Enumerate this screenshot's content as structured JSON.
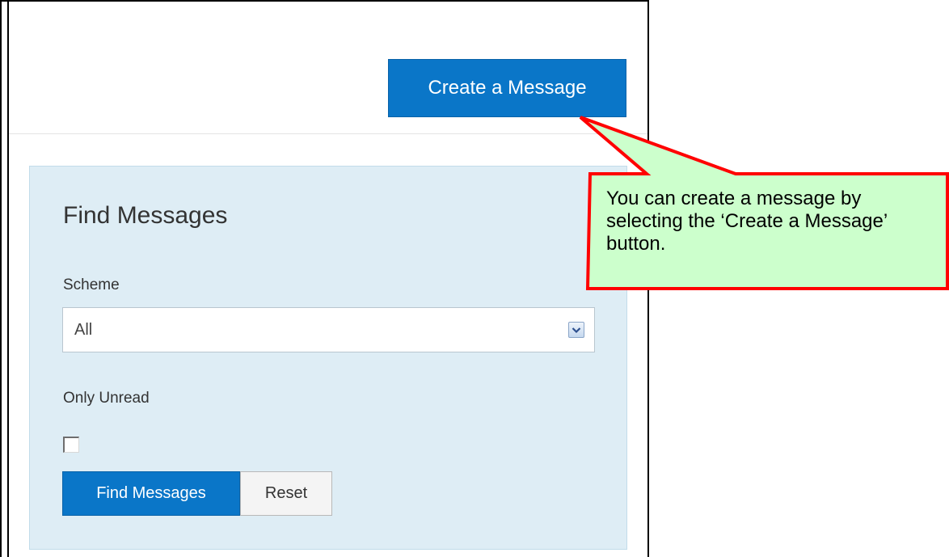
{
  "header": {
    "create_button_label": "Create a Message"
  },
  "filter_panel": {
    "title": "Find Messages",
    "scheme": {
      "label": "Scheme",
      "selected_value": "All"
    },
    "only_unread": {
      "label": "Only Unread",
      "checked": false
    },
    "find_button_label": "Find Messages",
    "reset_button_label": "Reset"
  },
  "callout": {
    "text": "You can create a message by selecting the ‘Create a Message’ button.",
    "fill_color": "#ccffcc",
    "border_color": "#ff0000"
  },
  "colors": {
    "primary_button": "#0a76c8",
    "panel_background": "#deedf5"
  },
  "icons": {
    "select_arrow": "chevron-down-icon"
  }
}
